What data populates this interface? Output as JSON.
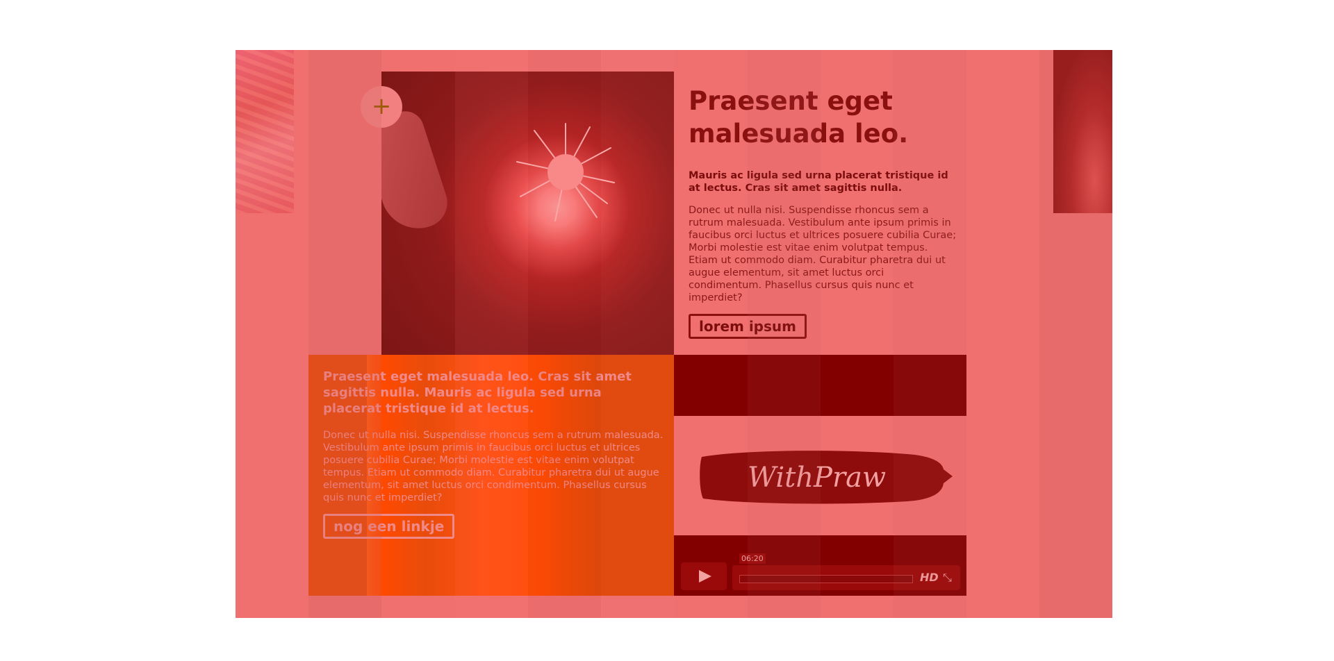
{
  "intro": {
    "title": "Praesent eget malesuada leo.",
    "lead": "Mauris ac ligula sed urna placerat tristique id at lectus. Cras sit amet sagittis nulla.",
    "body": "Donec ut nulla nisi. Suspendisse rhoncus sem a rutrum malesuada. Vestibulum ante ipsum primis in faucibus orci luctus et ultrices posuere cubilia Curae; Morbi molestie est vitae enim volutpat tempus. Etiam ut commodo diam. Curabitur pharetra dui ut augue elementum, sit amet luctus orci condimentum. Phasellus cursus quis nunc et imperdiet?",
    "button_label": "lorem ipsum"
  },
  "feature": {
    "title": "Praesent eget malesuada leo. Cras sit amet sagittis nulla. Mauris ac ligula sed urna placerat tristique id at lectus.",
    "body": "Donec ut nulla nisi. Suspendisse rhoncus sem a rutrum malesuada. Vestibulum ante ipsum primis in faucibus orci luctus et ultrices posuere cubilia Curae; Morbi molestie est vitae enim volutpat tempus. Etiam ut commodo diam. Curabitur pharetra dui ut augue elementum, sit amet luctus orci condimentum. Phasellus cursus quis nunc et imperdiet?",
    "button_label": "nog een linkje"
  },
  "plus_button": {
    "symbol": "+"
  },
  "video": {
    "logo_text": "WithPraw",
    "time_tooltip": "06:20",
    "hd_label": "HD",
    "fullscreen_symbol": "⤡",
    "progress_fraction": 0.0
  },
  "colors": {
    "accent_red": "#8a1010",
    "overlay_pink": "#f07070",
    "orange": "#ff4a00",
    "dark_red": "#820000"
  }
}
